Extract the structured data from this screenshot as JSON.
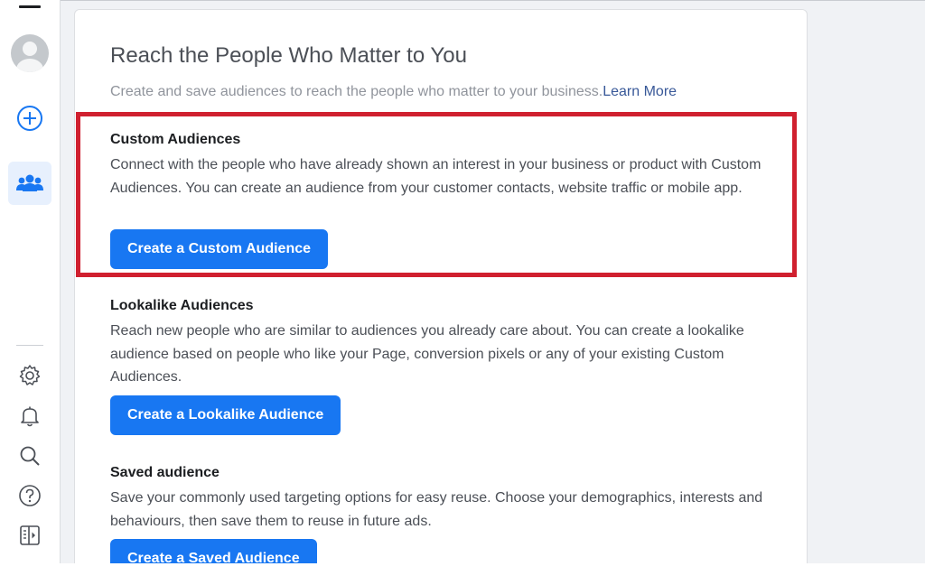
{
  "sidebar": {
    "icons": {
      "menu": "menu-icon",
      "avatar": "avatar",
      "create": "plus-circle-icon",
      "audiences": "people-icon",
      "settings": "gear-icon",
      "notifications": "bell-icon",
      "search": "search-icon",
      "help": "question-icon",
      "toggle": "panel-toggle-icon"
    }
  },
  "main": {
    "title": "Reach the People Who Matter to You",
    "subtitle": "Create and save audiences to reach the people who matter to your business.",
    "learn_more": "Learn More",
    "sections": [
      {
        "heading": "Custom Audiences",
        "description": "Connect with the people who have already shown an interest in your business or product with Custom Audiences. You can create an audience from your customer contacts, website traffic or mobile app.",
        "button": "Create a Custom Audience"
      },
      {
        "heading": "Lookalike Audiences",
        "description": "Reach new people who are similar to audiences you already care about. You can create a lookalike audience based on people who like your Page, conversion pixels or any of your existing Custom Audiences.",
        "button": "Create a Lookalike Audience"
      },
      {
        "heading": "Saved audience",
        "description": "Save your commonly used targeting options for easy reuse. Choose your demographics, interests and behaviours, then save them to reuse in future ads.",
        "button": "Create a Saved Audience"
      }
    ]
  },
  "colors": {
    "primary_button": "#1877f2",
    "highlight_border": "#d0202f",
    "link": "#385898",
    "rail_active_bg": "#e7f0fd"
  }
}
